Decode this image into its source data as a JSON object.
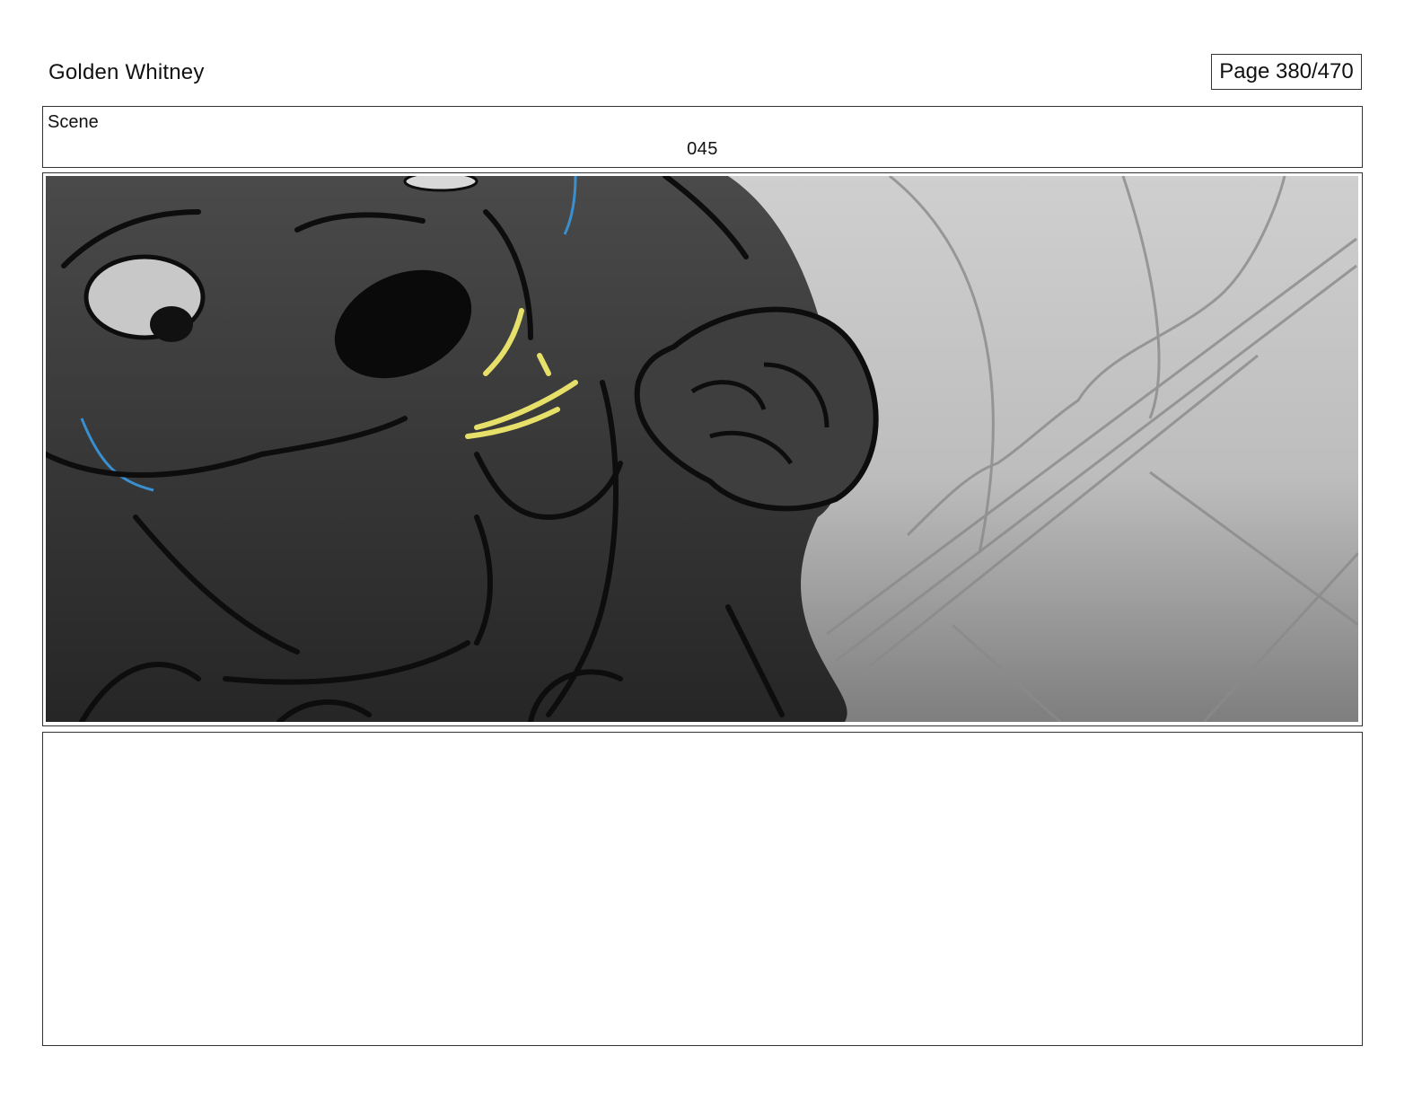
{
  "header": {
    "project_title": "Golden Whitney",
    "page_label": "Page 380/470"
  },
  "scene": {
    "label": "Scene",
    "number": "045"
  },
  "panel": {
    "icon": "storyboard-sketch-image",
    "colors": {
      "highlight": "#e6e06a",
      "accent_line": "#3a8fd0",
      "ink": "#111111"
    }
  },
  "notes": {}
}
